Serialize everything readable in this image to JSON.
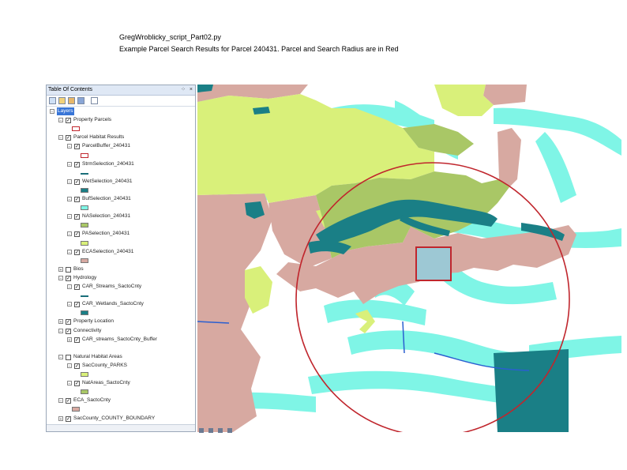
{
  "caption": {
    "line1": "GregWroblicky_script_Part02.py",
    "line2": "Example Parcel Search Results for Parcel 240431. Parcel  and Search Radius are in Red"
  },
  "toc": {
    "title": "Table Of Contents",
    "pin_glyph": "⁘",
    "close_glyph": "×",
    "layers": [
      {
        "label": "Layers",
        "indent": 0,
        "expander": "−",
        "checkbox": false,
        "checked": false,
        "symbol": "none",
        "selected": true
      },
      {
        "label": "Property Parcels",
        "indent": 1,
        "expander": "−",
        "checkbox": true,
        "checked": true,
        "symbol": "none"
      },
      {
        "label": "",
        "indent": 2,
        "expander": "",
        "checkbox": false,
        "checked": false,
        "symbol": "outline"
      },
      {
        "label": "Parcel Habitat Results",
        "indent": 1,
        "expander": "−",
        "checkbox": true,
        "checked": true,
        "symbol": "none"
      },
      {
        "label": "ParcelBuffer_240431",
        "indent": 2,
        "expander": "−",
        "checkbox": true,
        "checked": true,
        "symbol": "none"
      },
      {
        "label": "",
        "indent": 3,
        "expander": "",
        "checkbox": false,
        "checked": false,
        "symbol": "outline"
      },
      {
        "label": "StrmSelection_240431",
        "indent": 2,
        "expander": "−",
        "checkbox": true,
        "checked": true,
        "symbol": "none"
      },
      {
        "label": "",
        "indent": 3,
        "expander": "",
        "checkbox": false,
        "checked": false,
        "symbol": "line"
      },
      {
        "label": "WetSelection_240431",
        "indent": 2,
        "expander": "−",
        "checkbox": true,
        "checked": true,
        "symbol": "none"
      },
      {
        "label": "",
        "indent": 3,
        "expander": "",
        "checkbox": false,
        "checked": false,
        "symbol": "fill",
        "color": "#1a7f86"
      },
      {
        "label": "BufSelection_240431",
        "indent": 2,
        "expander": "−",
        "checkbox": true,
        "checked": true,
        "symbol": "none"
      },
      {
        "label": "",
        "indent": 3,
        "expander": "",
        "checkbox": false,
        "checked": false,
        "symbol": "fill",
        "color": "#7ff5e6"
      },
      {
        "label": "NASelection_240431",
        "indent": 2,
        "expander": "−",
        "checkbox": true,
        "checked": true,
        "symbol": "none"
      },
      {
        "label": "",
        "indent": 3,
        "expander": "",
        "checkbox": false,
        "checked": false,
        "symbol": "fill",
        "color": "#a9c766"
      },
      {
        "label": "PASelection_240431",
        "indent": 2,
        "expander": "−",
        "checkbox": true,
        "checked": true,
        "symbol": "none"
      },
      {
        "label": "",
        "indent": 3,
        "expander": "",
        "checkbox": false,
        "checked": false,
        "symbol": "fill",
        "color": "#d9f07a"
      },
      {
        "label": "ECASelection_240431",
        "indent": 2,
        "expander": "−",
        "checkbox": true,
        "checked": true,
        "symbol": "none"
      },
      {
        "label": "",
        "indent": 3,
        "expander": "",
        "checkbox": false,
        "checked": false,
        "symbol": "fill",
        "color": "#d7a9a1"
      },
      {
        "label": "Bios",
        "indent": 1,
        "expander": "+",
        "checkbox": true,
        "checked": false,
        "symbol": "none"
      },
      {
        "label": "Hydrology",
        "indent": 1,
        "expander": "−",
        "checkbox": true,
        "checked": true,
        "symbol": "none"
      },
      {
        "label": "CAR_Streams_SactoCnty",
        "indent": 2,
        "expander": "−",
        "checkbox": true,
        "checked": true,
        "symbol": "none"
      },
      {
        "label": "",
        "indent": 3,
        "expander": "",
        "checkbox": false,
        "checked": false,
        "symbol": "line"
      },
      {
        "label": "CAR_Wetlands_SactoCnty",
        "indent": 2,
        "expander": "−",
        "checkbox": true,
        "checked": true,
        "symbol": "none"
      },
      {
        "label": "",
        "indent": 3,
        "expander": "",
        "checkbox": false,
        "checked": false,
        "symbol": "fill",
        "color": "#1a7f86"
      },
      {
        "label": "Property Location",
        "indent": 1,
        "expander": "+",
        "checkbox": true,
        "checked": true,
        "symbol": "none"
      },
      {
        "label": "Connectivity",
        "indent": 1,
        "expander": "−",
        "checkbox": true,
        "checked": true,
        "symbol": "none"
      },
      {
        "label": "CAR_streams_SactoCnty_Buffer",
        "indent": 2,
        "expander": "+",
        "checkbox": true,
        "checked": true,
        "symbol": "none"
      },
      {
        "label": "",
        "indent": 3,
        "expander": "",
        "checkbox": false,
        "checked": false,
        "symbol": "none"
      },
      {
        "label": "Natural Habitat Areas",
        "indent": 1,
        "expander": "−",
        "checkbox": true,
        "checked": false,
        "symbol": "none"
      },
      {
        "label": "SacCounty_PARKS",
        "indent": 2,
        "expander": "−",
        "checkbox": true,
        "checked": true,
        "symbol": "none"
      },
      {
        "label": "",
        "indent": 3,
        "expander": "",
        "checkbox": false,
        "checked": false,
        "symbol": "fill",
        "color": "#d9f07a"
      },
      {
        "label": "NatAreas_SactoCnty",
        "indent": 2,
        "expander": "−",
        "checkbox": true,
        "checked": true,
        "symbol": "none"
      },
      {
        "label": "",
        "indent": 3,
        "expander": "",
        "checkbox": false,
        "checked": false,
        "symbol": "fill",
        "color": "#a9c766"
      },
      {
        "label": "ECA_SactoCnty",
        "indent": 1,
        "expander": "−",
        "checkbox": true,
        "checked": true,
        "symbol": "none"
      },
      {
        "label": "",
        "indent": 2,
        "expander": "",
        "checkbox": false,
        "checked": false,
        "symbol": "fill",
        "color": "#d7a9a1"
      },
      {
        "label": "SacCounty_COUNTY_BOUNDARY",
        "indent": 1,
        "expander": "+",
        "checkbox": true,
        "checked": true,
        "symbol": "none"
      }
    ]
  },
  "map": {
    "colors": {
      "eca": "#d7a9a1",
      "parks": "#d9f07a",
      "natural_areas": "#a9c766",
      "wetlands": "#1a7f86",
      "stream_buffer": "#7ff5e6",
      "streams": "#2a5fd0",
      "selection": "#c0262d",
      "background": "#ffffff"
    }
  }
}
